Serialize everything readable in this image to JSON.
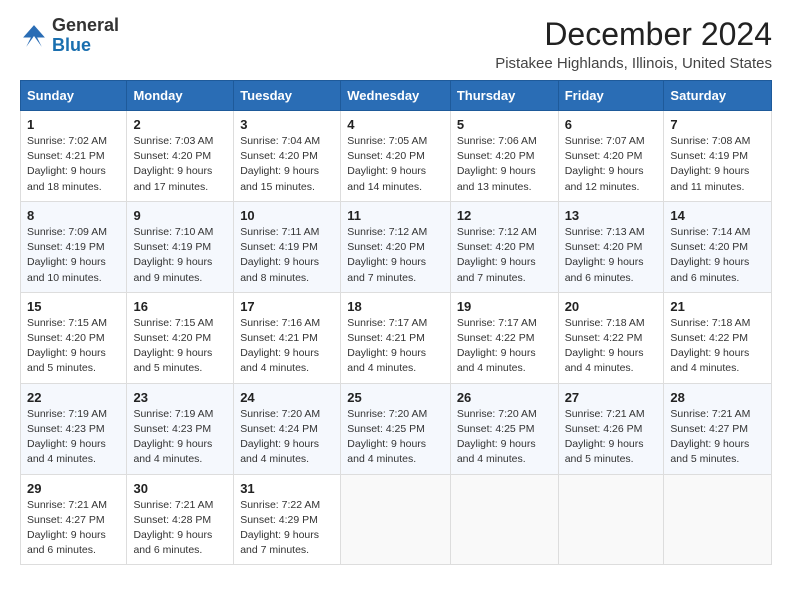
{
  "logo": {
    "general": "General",
    "blue": "Blue"
  },
  "title": "December 2024",
  "location": "Pistakee Highlands, Illinois, United States",
  "headers": [
    "Sunday",
    "Monday",
    "Tuesday",
    "Wednesday",
    "Thursday",
    "Friday",
    "Saturday"
  ],
  "weeks": [
    [
      {
        "day": "1",
        "sunrise": "7:02 AM",
        "sunset": "4:21 PM",
        "daylight": "9 hours and 18 minutes."
      },
      {
        "day": "2",
        "sunrise": "7:03 AM",
        "sunset": "4:20 PM",
        "daylight": "9 hours and 17 minutes."
      },
      {
        "day": "3",
        "sunrise": "7:04 AM",
        "sunset": "4:20 PM",
        "daylight": "9 hours and 15 minutes."
      },
      {
        "day": "4",
        "sunrise": "7:05 AM",
        "sunset": "4:20 PM",
        "daylight": "9 hours and 14 minutes."
      },
      {
        "day": "5",
        "sunrise": "7:06 AM",
        "sunset": "4:20 PM",
        "daylight": "9 hours and 13 minutes."
      },
      {
        "day": "6",
        "sunrise": "7:07 AM",
        "sunset": "4:20 PM",
        "daylight": "9 hours and 12 minutes."
      },
      {
        "day": "7",
        "sunrise": "7:08 AM",
        "sunset": "4:19 PM",
        "daylight": "9 hours and 11 minutes."
      }
    ],
    [
      {
        "day": "8",
        "sunrise": "7:09 AM",
        "sunset": "4:19 PM",
        "daylight": "9 hours and 10 minutes."
      },
      {
        "day": "9",
        "sunrise": "7:10 AM",
        "sunset": "4:19 PM",
        "daylight": "9 hours and 9 minutes."
      },
      {
        "day": "10",
        "sunrise": "7:11 AM",
        "sunset": "4:19 PM",
        "daylight": "9 hours and 8 minutes."
      },
      {
        "day": "11",
        "sunrise": "7:12 AM",
        "sunset": "4:20 PM",
        "daylight": "9 hours and 7 minutes."
      },
      {
        "day": "12",
        "sunrise": "7:12 AM",
        "sunset": "4:20 PM",
        "daylight": "9 hours and 7 minutes."
      },
      {
        "day": "13",
        "sunrise": "7:13 AM",
        "sunset": "4:20 PM",
        "daylight": "9 hours and 6 minutes."
      },
      {
        "day": "14",
        "sunrise": "7:14 AM",
        "sunset": "4:20 PM",
        "daylight": "9 hours and 6 minutes."
      }
    ],
    [
      {
        "day": "15",
        "sunrise": "7:15 AM",
        "sunset": "4:20 PM",
        "daylight": "9 hours and 5 minutes."
      },
      {
        "day": "16",
        "sunrise": "7:15 AM",
        "sunset": "4:20 PM",
        "daylight": "9 hours and 5 minutes."
      },
      {
        "day": "17",
        "sunrise": "7:16 AM",
        "sunset": "4:21 PM",
        "daylight": "9 hours and 4 minutes."
      },
      {
        "day": "18",
        "sunrise": "7:17 AM",
        "sunset": "4:21 PM",
        "daylight": "9 hours and 4 minutes."
      },
      {
        "day": "19",
        "sunrise": "7:17 AM",
        "sunset": "4:22 PM",
        "daylight": "9 hours and 4 minutes."
      },
      {
        "day": "20",
        "sunrise": "7:18 AM",
        "sunset": "4:22 PM",
        "daylight": "9 hours and 4 minutes."
      },
      {
        "day": "21",
        "sunrise": "7:18 AM",
        "sunset": "4:22 PM",
        "daylight": "9 hours and 4 minutes."
      }
    ],
    [
      {
        "day": "22",
        "sunrise": "7:19 AM",
        "sunset": "4:23 PM",
        "daylight": "9 hours and 4 minutes."
      },
      {
        "day": "23",
        "sunrise": "7:19 AM",
        "sunset": "4:23 PM",
        "daylight": "9 hours and 4 minutes."
      },
      {
        "day": "24",
        "sunrise": "7:20 AM",
        "sunset": "4:24 PM",
        "daylight": "9 hours and 4 minutes."
      },
      {
        "day": "25",
        "sunrise": "7:20 AM",
        "sunset": "4:25 PM",
        "daylight": "9 hours and 4 minutes."
      },
      {
        "day": "26",
        "sunrise": "7:20 AM",
        "sunset": "4:25 PM",
        "daylight": "9 hours and 4 minutes."
      },
      {
        "day": "27",
        "sunrise": "7:21 AM",
        "sunset": "4:26 PM",
        "daylight": "9 hours and 5 minutes."
      },
      {
        "day": "28",
        "sunrise": "7:21 AM",
        "sunset": "4:27 PM",
        "daylight": "9 hours and 5 minutes."
      }
    ],
    [
      {
        "day": "29",
        "sunrise": "7:21 AM",
        "sunset": "4:27 PM",
        "daylight": "9 hours and 6 minutes."
      },
      {
        "day": "30",
        "sunrise": "7:21 AM",
        "sunset": "4:28 PM",
        "daylight": "9 hours and 6 minutes."
      },
      {
        "day": "31",
        "sunrise": "7:22 AM",
        "sunset": "4:29 PM",
        "daylight": "9 hours and 7 minutes."
      },
      null,
      null,
      null,
      null
    ]
  ],
  "labels": {
    "sunrise": "Sunrise:",
    "sunset": "Sunset:",
    "daylight": "Daylight:"
  }
}
